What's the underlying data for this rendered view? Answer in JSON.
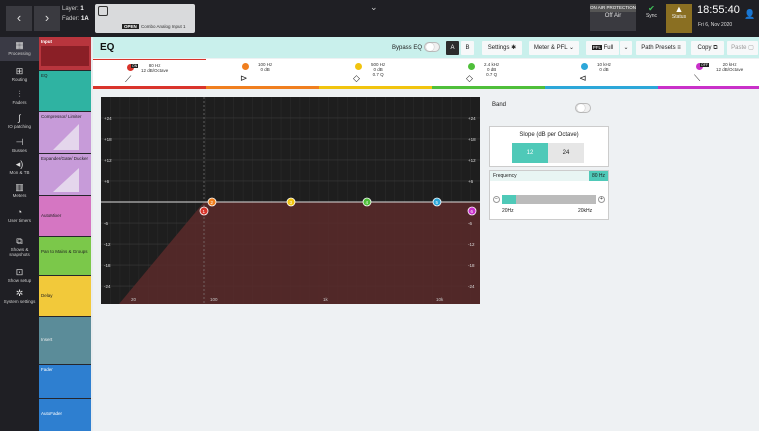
{
  "topbar": {
    "layer_label": "Layer:",
    "layer_value": "1",
    "fader_label": "Fader:",
    "fader_value": "1A",
    "channel_open": "OPEN",
    "channel_name": "Combo Analog Input 1",
    "on_air_protection": "ON AIR PROTECTION",
    "on_air_value": "Off Air",
    "sync_label": "Sync",
    "status_label": "Status",
    "time": "18:55:40",
    "date": "Fri 6, Nov 2020"
  },
  "sidebar": [
    {
      "label": "Processing",
      "icon": "grid-icon",
      "active": true
    },
    {
      "label": "Routing",
      "icon": "routing-icon"
    },
    {
      "label": "Faders",
      "icon": "faders-icon"
    },
    {
      "label": "IO patching",
      "icon": "patch-icon"
    },
    {
      "label": "Busses",
      "icon": "busses-icon"
    },
    {
      "label": "Mon & TB",
      "icon": "speaker-icon"
    },
    {
      "label": "Meters",
      "icon": "meters-icon"
    },
    {
      "label": "User timers",
      "icon": "timer-icon"
    },
    {
      "label": "Shows & snapshots",
      "icon": "snapshot-icon"
    },
    {
      "label": "Show setup",
      "icon": "setup-icon"
    },
    {
      "label": "System settings",
      "icon": "settings-icon"
    }
  ],
  "strip": {
    "input_label": "Input",
    "eq_label": "EQ",
    "comp_label": "Compressor/ Limiter",
    "gate_label": "Expander/Gate/ Ducker",
    "automixer_label": "AutoMixer",
    "pan_label": "Pan to Mains & Groups",
    "delay_label": "Delay",
    "insert_label": "Insert",
    "fader_label": "Fader",
    "autofader_label": "AutoFader"
  },
  "eq": {
    "title": "EQ",
    "bypass_label": "Bypass EQ",
    "a_label": "A",
    "b_label": "B",
    "settings_label": "Settings",
    "meter_label": "Meter & PFL",
    "full_label": "Full",
    "pfl_badge": "PFL",
    "presets_label": "Path Presets",
    "copy_label": "Copy",
    "paste_label": "Paste",
    "bands": [
      {
        "freq": "80 Hz",
        "detail": "12 dB/Octave",
        "color": "#d9342b",
        "badge": "ON"
      },
      {
        "freq": "100 Hz",
        "detail": "0 dB",
        "color": "#f07f1f"
      },
      {
        "freq": "500 Hz",
        "detail": "0 dB",
        "q": "0.7 Q",
        "color": "#f1c40f"
      },
      {
        "freq": "2.4 kHz",
        "detail": "0 dB",
        "q": "0.7 Q",
        "color": "#4fbf3a"
      },
      {
        "freq": "10 kHz",
        "detail": "0 dB",
        "color": "#2ca7d9"
      },
      {
        "freq": "20 kHz",
        "detail": "12 dB/Octave",
        "color": "#c930c9",
        "badge": "OFF"
      }
    ],
    "db_ticks": [
      "+24",
      "+18",
      "+12",
      "+6",
      "-6",
      "-12",
      "-18",
      "-24"
    ],
    "freq_ticks": [
      "20",
      "100",
      "1k",
      "10k"
    ],
    "node_labels": [
      "1",
      "2",
      "3",
      "4",
      "5",
      "6"
    ]
  },
  "panel": {
    "band_label": "Band",
    "slope_title": "Slope (dB per Octave)",
    "slope_12": "12",
    "slope_24": "24",
    "freq_label": "Frequency",
    "freq_value": "80 Hz",
    "slider_min": "20Hz",
    "slider_max": "20kHz",
    "slider_level": 0.15
  },
  "colors": {
    "accent": "#4fc9b8",
    "graph_bg": "#1e1e1e",
    "filter_fill": "#5a2a2a"
  }
}
